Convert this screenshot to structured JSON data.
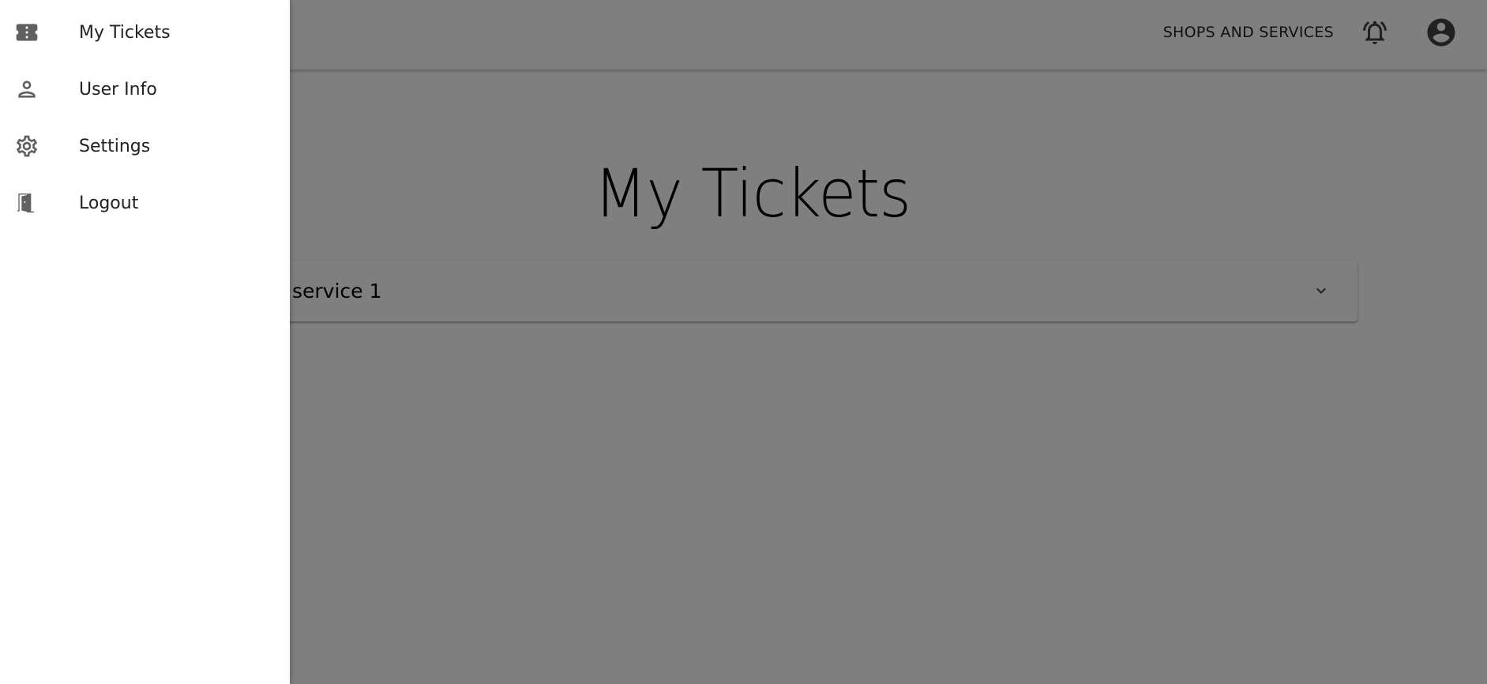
{
  "appbar": {
    "shops_link": "SHOPS AND SERVICES",
    "notification_icon": "bell-ring-icon",
    "account_icon": "account-circle-icon"
  },
  "main": {
    "title": "My Tickets",
    "panels": [
      {
        "title": "service 1",
        "expand_icon": "chevron-down-icon"
      }
    ]
  },
  "drawer": {
    "items": [
      {
        "label": "My Tickets",
        "icon": "ticket-icon"
      },
      {
        "label": "User Info",
        "icon": "person-icon"
      },
      {
        "label": "Settings",
        "icon": "gear-icon"
      },
      {
        "label": "Logout",
        "icon": "door-exit-icon"
      }
    ]
  },
  "colors": {
    "scrim": "#808080",
    "drawer_background": "#ffffff",
    "icon": "#616161",
    "text": "#222222"
  }
}
